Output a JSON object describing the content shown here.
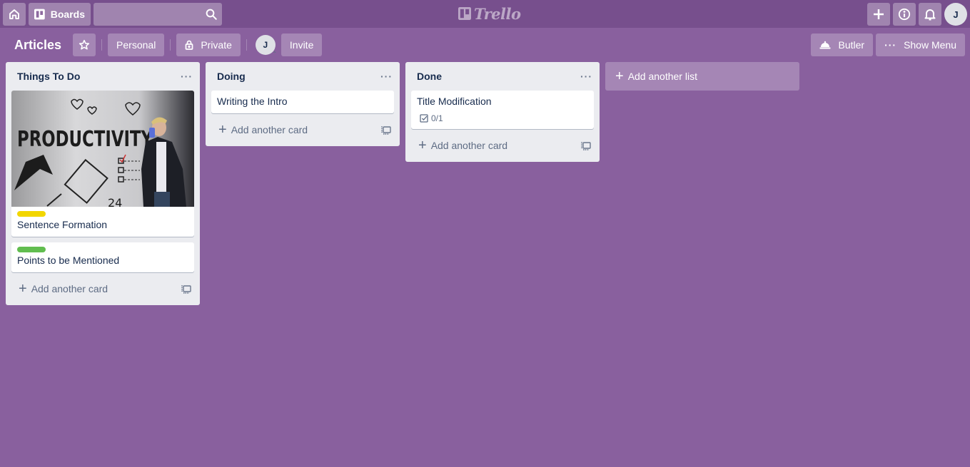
{
  "header": {
    "home_icon": "house-icon",
    "boards_label": "Boards",
    "search_placeholder": "",
    "search_value": "",
    "logo_text": "Trello",
    "create_icon": "plus-icon",
    "info_icon": "info-icon",
    "notifications_icon": "bell-icon",
    "user_initial": "J"
  },
  "board": {
    "title": "Articles",
    "star_icon": "star-icon",
    "team_label": "Personal",
    "visibility_label": "Private",
    "member_initial": "J",
    "invite_label": "Invite",
    "butler_label": "Butler",
    "show_menu_label": "Show Menu"
  },
  "lists": [
    {
      "title": "Things To Do",
      "cards": [
        {
          "title": "Sentence Formation",
          "label_color": "#f2d600",
          "cover": "productivity-wall-photo"
        },
        {
          "title": "Points to be Mentioned",
          "label_color": "#61bd4f"
        }
      ],
      "add_card_label": "Add another card"
    },
    {
      "title": "Doing",
      "cards": [
        {
          "title": "Writing the Intro"
        }
      ],
      "add_card_label": "Add another card"
    },
    {
      "title": "Done",
      "cards": [
        {
          "title": "Title Modification",
          "checklist": "0/1"
        }
      ],
      "add_card_label": "Add another card"
    }
  ],
  "add_list_label": "Add another list",
  "colors": {
    "board_bg": "#89609e",
    "header_bg": "#774f8d",
    "list_bg": "#ebecf0",
    "label_yellow": "#f2d600",
    "label_green": "#61bd4f"
  }
}
